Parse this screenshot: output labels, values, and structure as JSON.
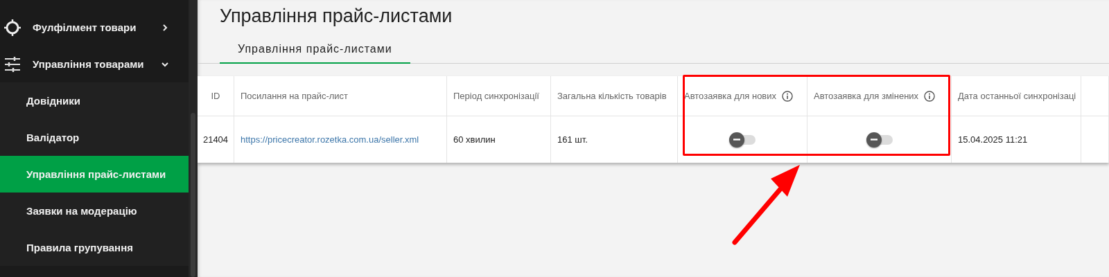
{
  "sidebar": {
    "items": [
      {
        "label": "Фулфілмент товари",
        "expanded": false
      },
      {
        "label": "Управління товарами",
        "expanded": true,
        "children": [
          {
            "label": "Довідники",
            "selected": false
          },
          {
            "label": "Валідатор",
            "selected": false
          },
          {
            "label": "Управління прайс-листами",
            "selected": true
          },
          {
            "label": "Заявки на модерацію",
            "selected": false
          },
          {
            "label": "Правила групування",
            "selected": false
          }
        ]
      }
    ]
  },
  "page": {
    "title": "Управління прайс-листами"
  },
  "tabs": [
    {
      "label": "Управління прайс-листами",
      "selected": true
    }
  ],
  "table": {
    "columns": [
      {
        "label": "ID",
        "info": false
      },
      {
        "label": "Посилання на прайс-лист",
        "info": false
      },
      {
        "label": "Період синхронізації",
        "info": false
      },
      {
        "label": "Загальна кількість товарів",
        "info": false
      },
      {
        "label": "Автозаявка для нових",
        "info": true
      },
      {
        "label": "Автозаявка для змінених",
        "info": true
      },
      {
        "label": "Дата останньої синхронізаці",
        "info": false
      }
    ],
    "rows": [
      {
        "cells": [
          {
            "kind": "text",
            "text": "21404"
          },
          {
            "kind": "link",
            "text": "https://pricecreator.rozetka.com.ua/seller.xml"
          },
          {
            "kind": "text",
            "text": "60 хвилин"
          },
          {
            "kind": "text",
            "text": "161 шт."
          },
          {
            "kind": "toggle",
            "on": false
          },
          {
            "kind": "toggle",
            "on": false
          },
          {
            "kind": "text",
            "text": "15.04.2025 11:21"
          }
        ]
      }
    ]
  },
  "annotations": [
    {
      "kind": "frame"
    },
    {
      "kind": "arrow"
    }
  ]
}
